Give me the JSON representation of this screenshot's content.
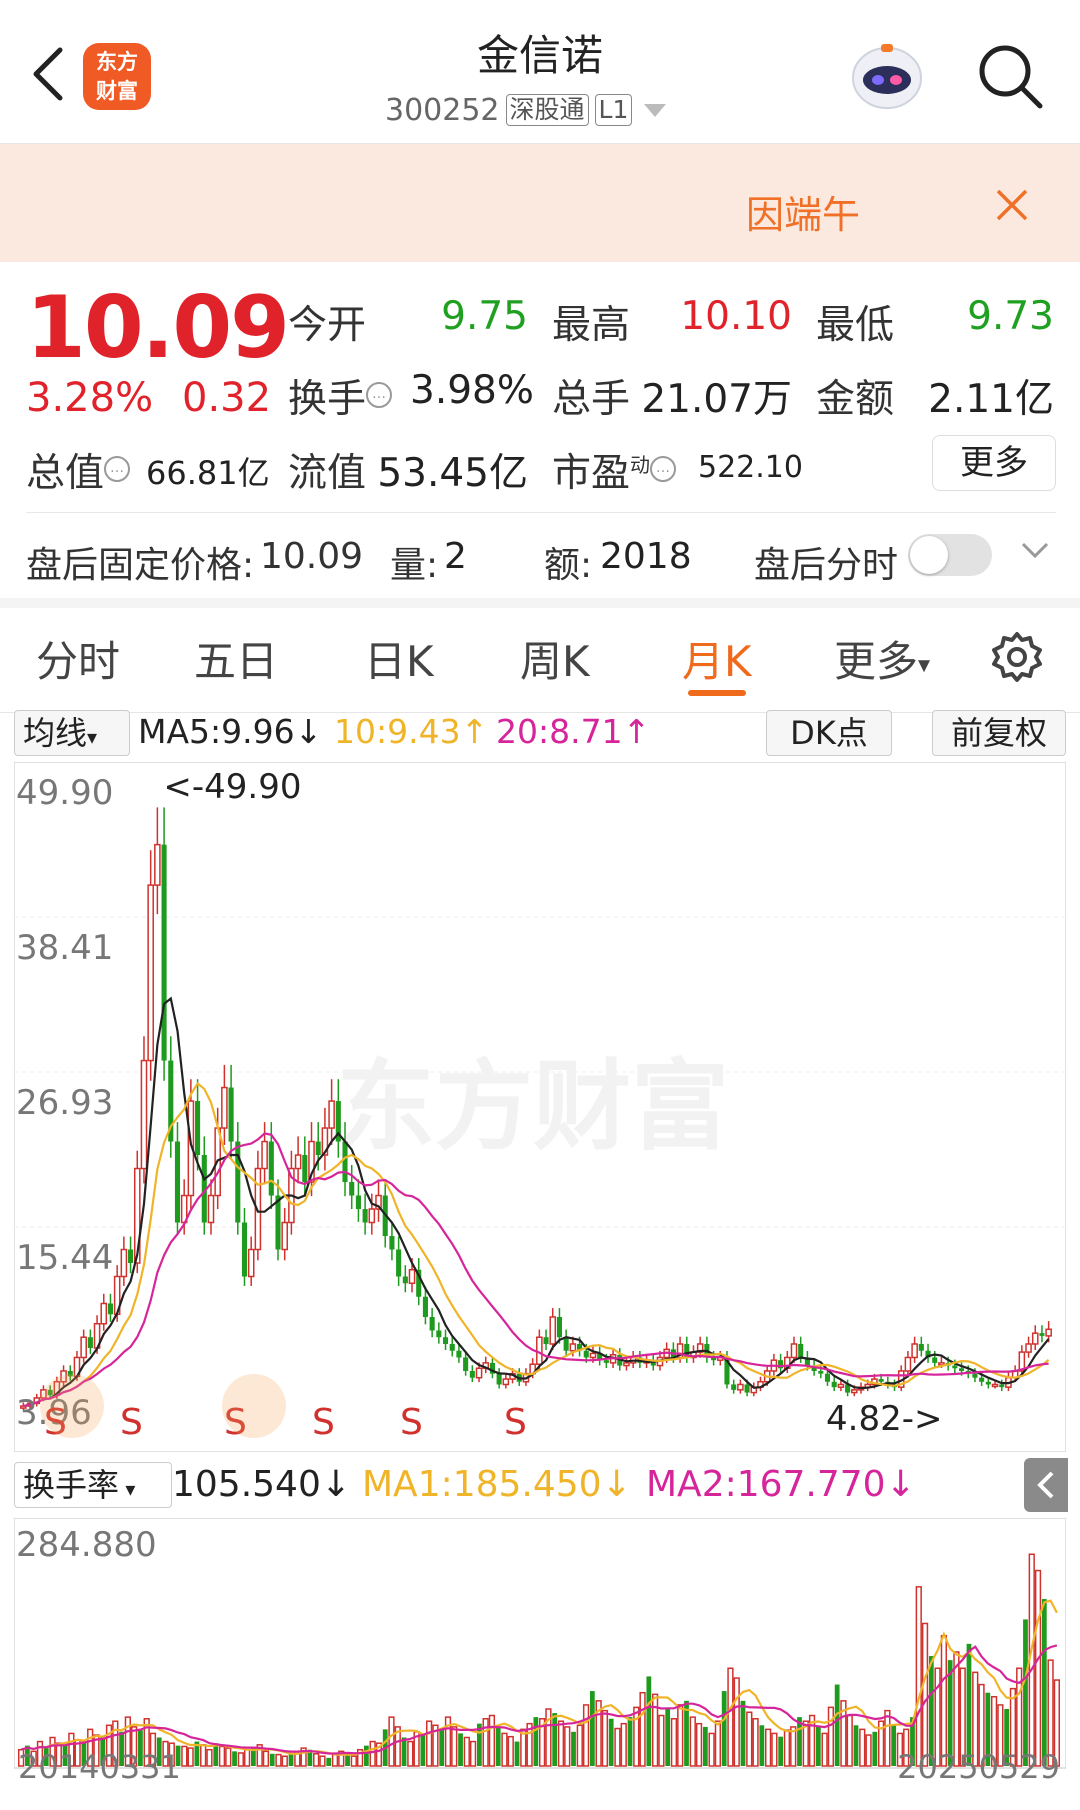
{
  "header": {
    "logo_line1": "东方",
    "logo_line2": "财富",
    "stock_name": "金信诺",
    "stock_code": "300252",
    "tag1": "深股通",
    "tag2": "L1"
  },
  "banner": {
    "text": "因端午"
  },
  "quote": {
    "price": "10.09",
    "change_pct": "3.28%",
    "change_amt": "0.32",
    "open_label": "今开",
    "open": "9.75",
    "high_label": "最高",
    "high": "10.10",
    "low_label": "最低",
    "low": "9.73",
    "turnover_label": "换手",
    "turnover": "3.98%",
    "volume_label": "总手",
    "volume": "21.07万",
    "amount_label": "金额",
    "amount": "2.11亿",
    "mcap_label": "总值",
    "mcap": "66.81亿",
    "float_label": "流值",
    "float_mcap": "53.45亿",
    "pe_label": "市盈",
    "pe_sup": "动",
    "pe": "522.10",
    "more_label": "更多"
  },
  "after_hours": {
    "price_label": "盘后固定价格:",
    "price": "10.09",
    "vol_label": "量:",
    "vol": "2",
    "amt_label": "额:",
    "amt": "2018",
    "minute_label": "盘后分时"
  },
  "tabs": [
    "分时",
    "五日",
    "日K",
    "周K",
    "月K",
    "更多"
  ],
  "active_tab": 4,
  "ma": {
    "selector": "均线",
    "ma5": "MA5:9.96↓",
    "ma10": "10:9.43↑",
    "ma20": "20:8.71↑",
    "dk_label": "DK点",
    "adjust_label": "前复权",
    "colors": {
      "ma5": "#222222",
      "ma10": "#f0b429",
      "ma20": "#d6259a"
    }
  },
  "chart_data": [
    {
      "type": "candlestick",
      "y_ticks": [
        "49.90",
        "38.41",
        "26.93",
        "15.44",
        "3.96"
      ],
      "ylim": [
        3.96,
        49.9
      ],
      "max_label": "<-49.90",
      "min_label": "4.82->",
      "signal_labels": [
        "S",
        "S",
        "S",
        "S",
        "S",
        "S"
      ],
      "up_color": "#d0312d",
      "down_color": "#1e9a1e",
      "close": [
        4.4,
        4.6,
        5.0,
        5.6,
        5.2,
        6.2,
        7.0,
        6.6,
        8.0,
        9.5,
        8.7,
        10.5,
        12.0,
        11.2,
        14.0,
        16.0,
        15.0,
        22.0,
        30.0,
        43.0,
        46.0,
        30.0,
        24.0,
        18.0,
        20.0,
        27.0,
        23.0,
        18.0,
        20.0,
        25.0,
        28.0,
        24.0,
        18.0,
        14.0,
        16.0,
        22.0,
        24.0,
        20.0,
        16.0,
        18.0,
        22.0,
        23.0,
        21.0,
        24.0,
        23.0,
        25.0,
        27.0,
        24.0,
        21.0,
        20.0,
        19.0,
        18.0,
        19.0,
        20.0,
        17.0,
        16.0,
        14.0,
        13.5,
        14.5,
        12.5,
        11.0,
        10.0,
        9.5,
        9.0,
        8.5,
        8.0,
        7.0,
        6.5,
        7.2,
        7.6,
        6.8,
        6.0,
        6.4,
        6.8,
        6.2,
        6.8,
        7.5,
        9.5,
        9.0,
        11.0,
        9.5,
        8.5,
        9.0,
        8.5,
        8.0,
        8.3,
        7.8,
        7.6,
        8.2,
        7.4,
        7.6,
        8.0,
        7.6,
        7.8,
        7.4,
        8.0,
        8.6,
        8.0,
        9.0,
        8.0,
        8.4,
        9.0,
        8.0,
        7.8,
        8.0,
        6.0,
        5.6,
        6.0,
        5.4,
        5.8,
        6.2,
        7.0,
        7.8,
        7.2,
        8.0,
        9.0,
        8.0,
        7.4,
        7.0,
        6.8,
        6.2,
        5.8,
        6.0,
        5.4,
        5.6,
        5.8,
        6.0,
        6.4,
        6.2,
        6.0,
        5.8,
        7.0,
        8.0,
        9.0,
        8.5,
        8.0,
        7.6,
        7.6,
        7.4,
        7.2,
        7.0,
        6.8,
        6.5,
        6.2,
        6.0,
        6.0,
        5.8,
        6.5,
        7.0,
        8.4,
        9.0,
        9.8,
        9.6,
        10.09
      ],
      "ma_note": "MA5 / MA10 / MA20 computed from closes"
    },
    {
      "type": "bar",
      "indicator": "换手率",
      "value_label": "105.540↓",
      "ma1_label": "MA1:185.450↓",
      "ma2_label": "MA2:167.770↓",
      "y_ticks": [
        "284.880"
      ],
      "ylim": [
        0,
        284.88
      ],
      "x_start": "20140331",
      "x_end": "20250529",
      "values": [
        20,
        25,
        18,
        30,
        22,
        35,
        28,
        26,
        40,
        32,
        30,
        45,
        38,
        35,
        50,
        55,
        42,
        60,
        48,
        44,
        58,
        40,
        35,
        30,
        28,
        25,
        24,
        22,
        30,
        26,
        20,
        28,
        24,
        22,
        18,
        16,
        20,
        22,
        26,
        18,
        15,
        14,
        12,
        16,
        18,
        22,
        20,
        15,
        12,
        10,
        14,
        18,
        16,
        12,
        20,
        25,
        30,
        28,
        45,
        60,
        48,
        35,
        30,
        42,
        38,
        55,
        50,
        45,
        60,
        48,
        40,
        35,
        30,
        52,
        58,
        62,
        48,
        40,
        36,
        30,
        45,
        52,
        60,
        58,
        70,
        65,
        55,
        48,
        42,
        50,
        75,
        92,
        80,
        68,
        58,
        46,
        52,
        60,
        72,
        90,
        110,
        88,
        62,
        70,
        58,
        75,
        80,
        60,
        52,
        48,
        40,
        55,
        92,
        120,
        108,
        80,
        66,
        58,
        50,
        45,
        40,
        36,
        44,
        48,
        60,
        55,
        62,
        48,
        40,
        72,
        100,
        80,
        62,
        50,
        45,
        38,
        42,
        55,
        68,
        50,
        40,
        45,
        60,
        220,
        175,
        135,
        120,
        160,
        130,
        140,
        120,
        150,
        115,
        100,
        90,
        85,
        75,
        70,
        95,
        120,
        180,
        260,
        240,
        205,
        130,
        105.54
      ]
    }
  ]
}
